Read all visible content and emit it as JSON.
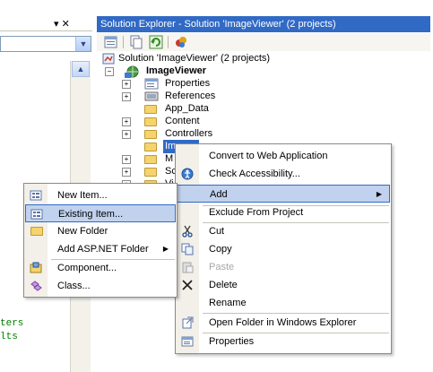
{
  "left_panel": {
    "header_controls": "▾ ✕",
    "code_lines": [
      "ters",
      "lts"
    ]
  },
  "solution_explorer": {
    "title": "Solution Explorer - Solution 'ImageViewer' (2 projects)",
    "tree": {
      "solution": "Solution 'ImageViewer' (2 projects)",
      "project": "ImageViewer",
      "items": [
        "Properties",
        "References",
        "App_Data",
        "Content",
        "Controllers",
        "Images"
      ],
      "partial_items": [
        "M",
        "Sc",
        "Vi"
      ]
    }
  },
  "context_menu": {
    "items": [
      {
        "label": "Convert to Web Application",
        "icon": "none"
      },
      {
        "label": "Check Accessibility...",
        "icon": "accessibility-icon"
      },
      {
        "label": "Add",
        "icon": "none",
        "submenu": true
      },
      {
        "label": "Exclude From Project",
        "icon": "none"
      },
      {
        "label": "Cut",
        "icon": "scissors-icon"
      },
      {
        "label": "Copy",
        "icon": "copy-icon"
      },
      {
        "label": "Paste",
        "icon": "paste-icon",
        "disabled": true
      },
      {
        "label": "Delete",
        "icon": "delete-icon"
      },
      {
        "label": "Rename",
        "icon": "none"
      },
      {
        "label": "Open Folder in Windows Explorer",
        "icon": "open-folder-icon"
      },
      {
        "label": "Properties",
        "icon": "properties-icon"
      }
    ]
  },
  "add_submenu": {
    "items": [
      {
        "label": "New Item...",
        "icon": "new-item-icon"
      },
      {
        "label": "Existing Item...",
        "icon": "existing-item-icon"
      },
      {
        "label": "New Folder",
        "icon": "folder-icon"
      },
      {
        "label": "Add ASP.NET Folder",
        "icon": "none",
        "submenu": true
      },
      {
        "label": "Component...",
        "icon": "component-icon"
      },
      {
        "label": "Class...",
        "icon": "class-icon"
      }
    ]
  },
  "colors": {
    "title_bar": "#316ac5",
    "highlight": "#c1d2ee",
    "menu_gutter": "#f2f0e8",
    "folder": "#f5d36d"
  }
}
